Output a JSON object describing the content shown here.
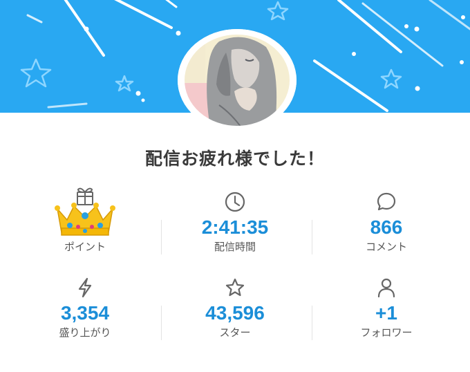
{
  "title": "配信お疲れ様でした！",
  "colors": {
    "banner": "#29a8f2",
    "accent": "#1b8ed8",
    "label": "#555555",
    "title": "#3a3a3a"
  },
  "stats": {
    "points": {
      "icon": "gift-icon",
      "value": "",
      "label": "ポイント",
      "badge": "crown-emoji"
    },
    "duration": {
      "icon": "clock-icon",
      "value": "2:41:35",
      "label": "配信時間"
    },
    "comments": {
      "icon": "speech-bubble-icon",
      "value": "866",
      "label": "コメント"
    },
    "boosts": {
      "icon": "lightning-icon",
      "value": "3,354",
      "label": "盛り上がり"
    },
    "stars": {
      "icon": "star-icon",
      "value": "43,596",
      "label": "スター"
    },
    "followers": {
      "icon": "person-icon",
      "value": "+1",
      "label": "フォロワー"
    }
  }
}
